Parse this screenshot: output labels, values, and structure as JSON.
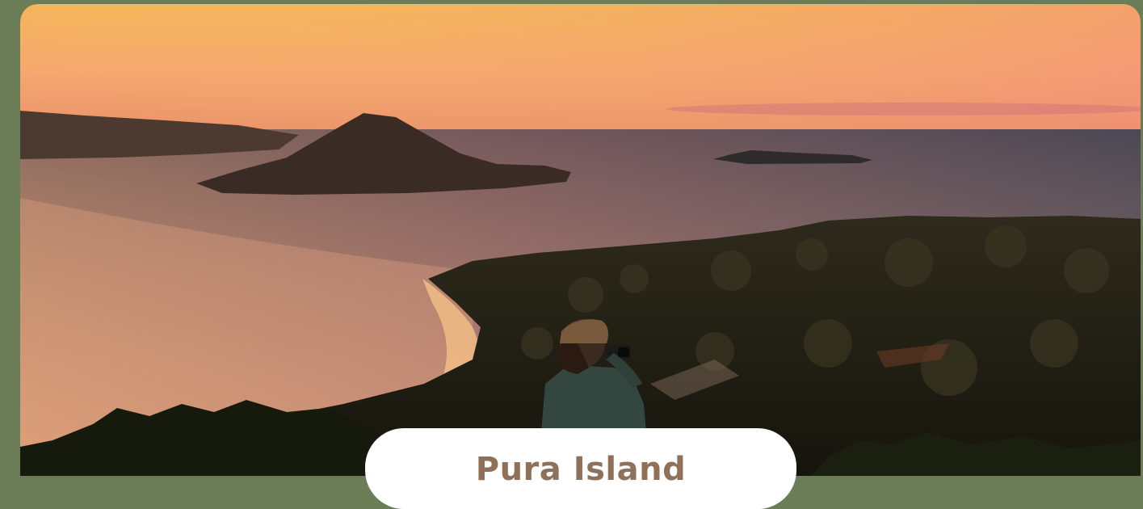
{
  "destination": {
    "title": "Pura Island",
    "image_subject": "photo"
  },
  "colors": {
    "page_background": "#6a7d56",
    "title_color": "#8f7058",
    "pill_background": "#ffffff"
  }
}
